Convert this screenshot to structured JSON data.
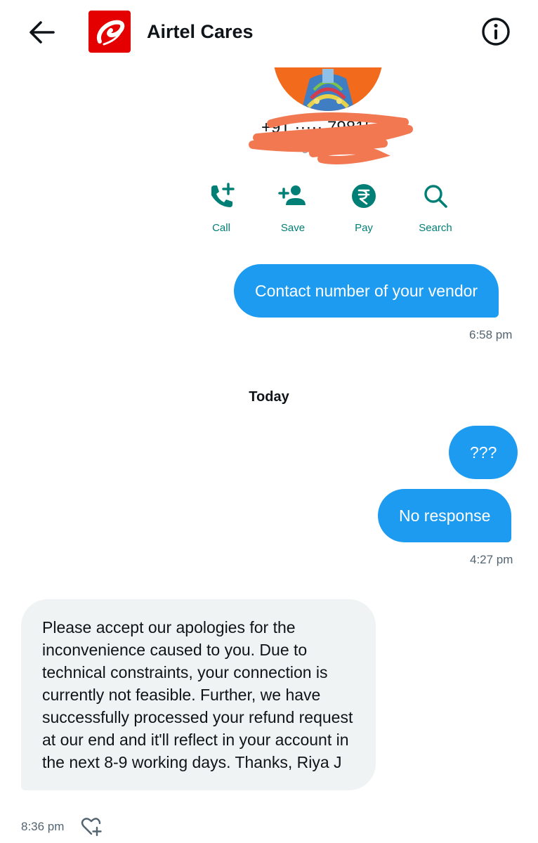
{
  "header": {
    "title": "Airtel Cares",
    "back_icon": "arrow-left-icon",
    "info_icon": "info-icon",
    "logo_color": "#e40000"
  },
  "profile": {
    "phone": "+91 ····· 79815",
    "subtitle": "5, Bai"
  },
  "actions": [
    {
      "label": "Call",
      "icon": "call-add-icon"
    },
    {
      "label": "Save",
      "icon": "add-person-icon"
    },
    {
      "label": "Pay",
      "icon": "rupee-icon"
    },
    {
      "label": "Search",
      "icon": "search-icon"
    }
  ],
  "accent_color": "#1d9bf0",
  "action_color": "#007f76",
  "messages": {
    "m1": "Contact number of your vendor",
    "t1": "6:58 pm",
    "day": "Today",
    "m2": "???",
    "m3": "No response",
    "t2": "4:27 pm",
    "reply": "Please accept our apologies for the inconvenience caused to you. Due to technical constraints, your connection is currently not feasible. Further, we have successfully processed your refund request at our end and it'll reflect in your account in the next 8-9 working days. Thanks, Riya J",
    "t3": "8:36 pm",
    "react_icon": "heart-plus-icon"
  }
}
